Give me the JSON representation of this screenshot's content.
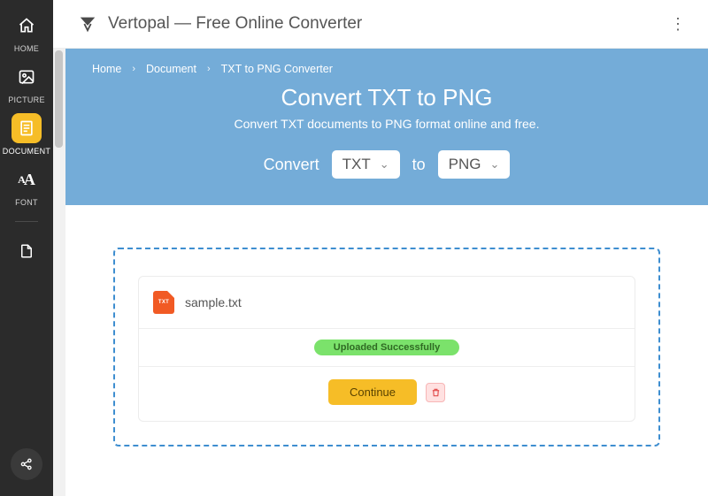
{
  "sidebar": {
    "items": [
      {
        "label": "HOME",
        "icon": "home-icon"
      },
      {
        "label": "PICTURE",
        "icon": "picture-icon"
      },
      {
        "label": "DOCUMENT",
        "icon": "document-icon"
      },
      {
        "label": "FONT",
        "icon": "font-icon"
      }
    ],
    "extra_items": [
      {
        "label": "",
        "icon": "file-icon"
      }
    ],
    "active_index": 2
  },
  "header": {
    "title": "Vertopal — Free Online Converter"
  },
  "breadcrumb": {
    "items": [
      "Home",
      "Document",
      "TXT to PNG Converter"
    ]
  },
  "hero": {
    "title": "Convert TXT to PNG",
    "subtitle": "Convert TXT documents to PNG format online and free.",
    "convert_label": "Convert",
    "from_value": "TXT",
    "to_label": "to",
    "to_value": "PNG"
  },
  "upload": {
    "file": {
      "badge": "TXT",
      "name": "sample.txt"
    },
    "status": "Uploaded Successfully",
    "continue_label": "Continue"
  },
  "colors": {
    "accent": "#f6bd27",
    "hero_bg": "#74acd8",
    "success_bg": "#7be26b",
    "file_badge": "#f15a24"
  }
}
